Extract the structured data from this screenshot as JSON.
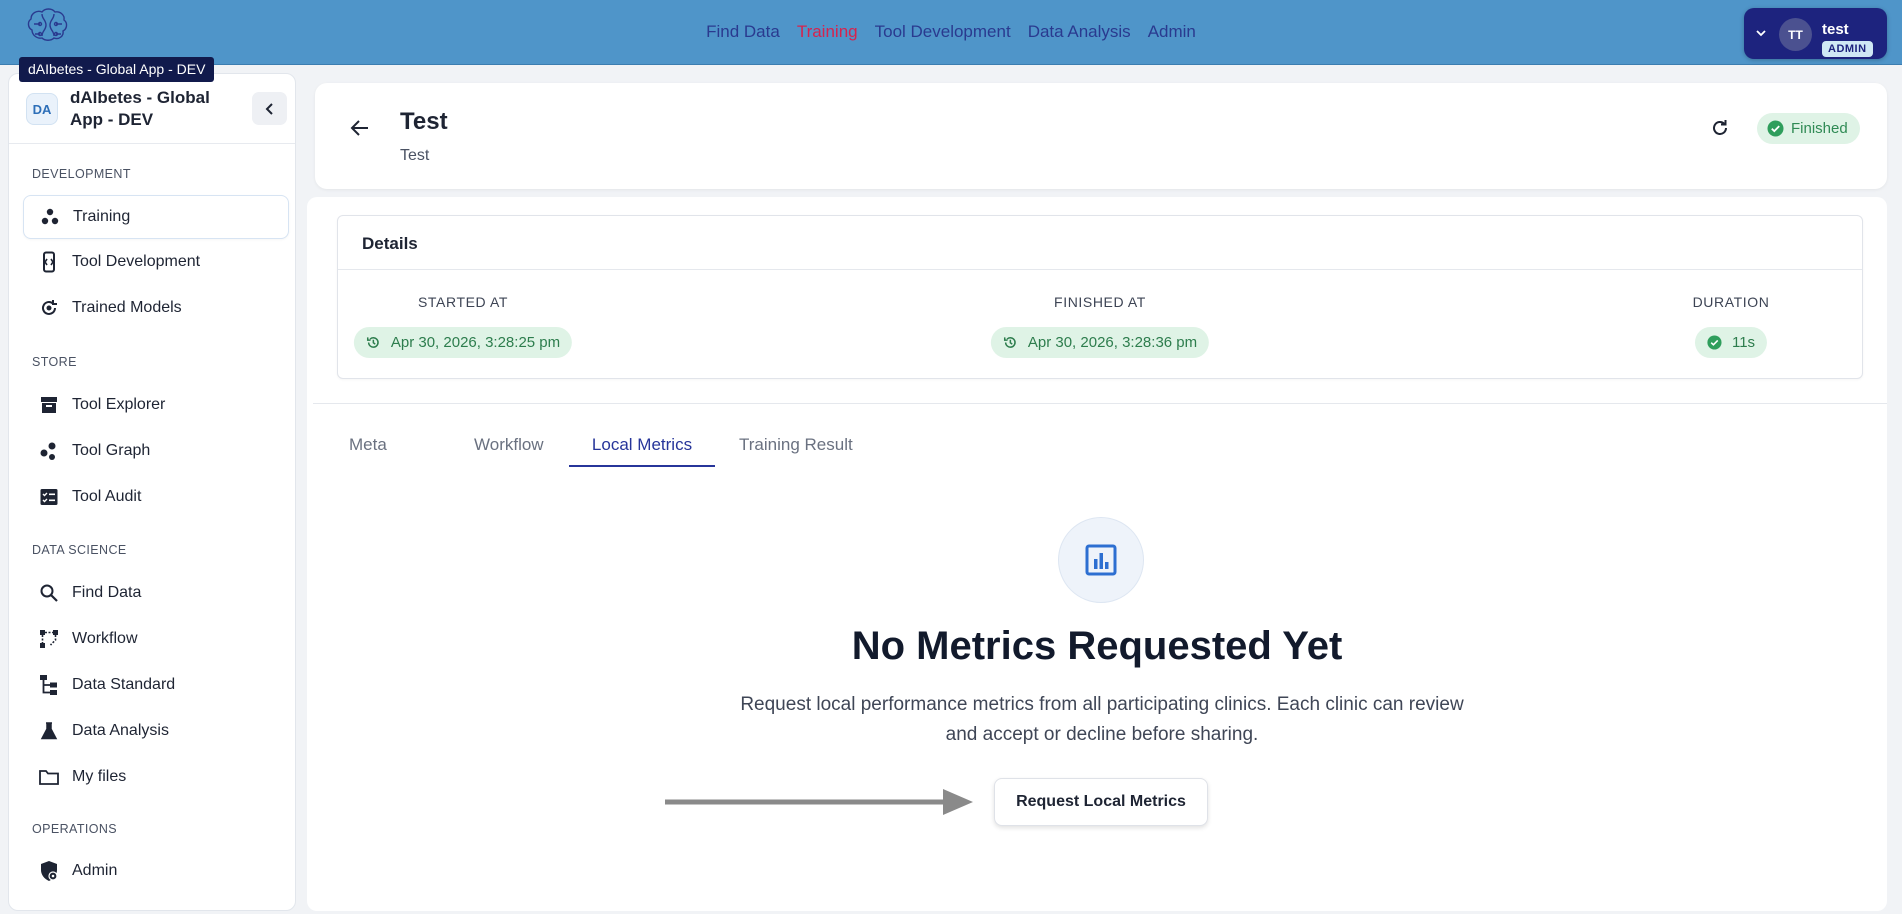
{
  "app": {
    "logo_tooltip": "dAIbetes - Global App - DEV",
    "logo_text": "dAIbetes"
  },
  "topnav": {
    "items": [
      "Find Data",
      "Training",
      "Tool Development",
      "Data Analysis",
      "Admin"
    ],
    "active": "Training",
    "active_color": "#d6234e",
    "link_color": "#2a3a8f"
  },
  "user": {
    "initials": "TT",
    "name": "test",
    "role": "ADMIN"
  },
  "sidebar": {
    "badge": "DA",
    "title": "dAIbetes - Global App - DEV",
    "sections": [
      {
        "label": "DEVELOPMENT",
        "items": [
          {
            "label": "Training",
            "icon": "training-icon",
            "active": true
          },
          {
            "label": "Tool Development",
            "icon": "tool-development-icon"
          },
          {
            "label": "Trained Models",
            "icon": "trained-models-icon"
          }
        ]
      },
      {
        "label": "STORE",
        "items": [
          {
            "label": "Tool Explorer",
            "icon": "archive-icon"
          },
          {
            "label": "Tool Graph",
            "icon": "graph-icon"
          },
          {
            "label": "Tool Audit",
            "icon": "audit-icon"
          }
        ]
      },
      {
        "label": "DATA SCIENCE",
        "items": [
          {
            "label": "Find Data",
            "icon": "search-icon"
          },
          {
            "label": "Workflow",
            "icon": "workflow-icon"
          },
          {
            "label": "Data Standard",
            "icon": "data-standard-icon"
          },
          {
            "label": "Data Analysis",
            "icon": "flask-icon"
          },
          {
            "label": "My files",
            "icon": "folder-icon"
          }
        ]
      },
      {
        "label": "OPERATIONS",
        "items": [
          {
            "label": "Admin",
            "icon": "admin-shield-icon"
          }
        ]
      }
    ]
  },
  "header": {
    "title": "Test",
    "subtitle": "Test",
    "status": "Finished",
    "status_color": "#2f8a54"
  },
  "details": {
    "title": "Details",
    "started_label": "STARTED AT",
    "started_value": "Apr 30, 2026, 3:28:25 pm",
    "finished_label": "FINISHED AT",
    "finished_value": "Apr 30, 2026, 3:28:36 pm",
    "duration_label": "DURATION",
    "duration_value": "11s"
  },
  "tabs": {
    "items": [
      "Meta",
      "Workflow",
      "Local Metrics",
      "Training Result"
    ],
    "active": "Local Metrics",
    "active_color": "#27359a"
  },
  "empty_state": {
    "icon": "bar-chart-icon",
    "title": "No Metrics Requested Yet",
    "description": "Request local performance metrics from all participating clinics. Each clinic can review and accept or decline before sharing.",
    "button_label": "Request Local Metrics"
  }
}
